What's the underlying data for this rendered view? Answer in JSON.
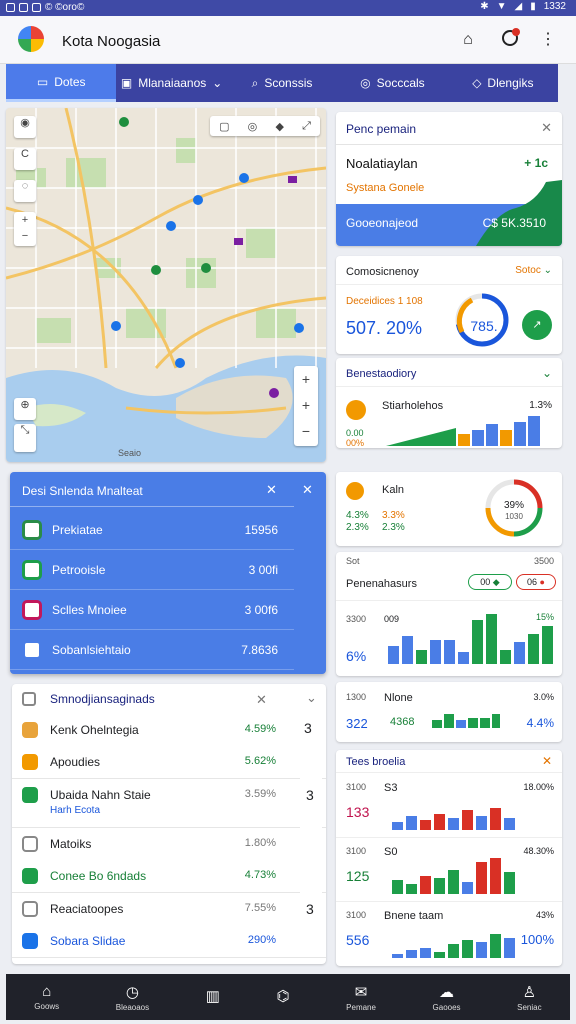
{
  "status": {
    "left": "© ©oro©",
    "right": "1332"
  },
  "header": {
    "title": "Kota Noogasia"
  },
  "tabs": [
    {
      "label": "Dotes",
      "active": true
    },
    {
      "label": "Mlanaiaanos",
      "active": false
    },
    {
      "label": "Sconssis",
      "active": false
    },
    {
      "label": "Socccals",
      "active": false
    },
    {
      "label": "Dlengiks",
      "active": false
    }
  ],
  "map": {
    "attribution": "Seaio"
  },
  "panel": {
    "title": "Penc pemain",
    "name": "Noalatiaylan",
    "change": "+ 1c",
    "subtitle": "Systana Gonele",
    "footer_label": "Gooeonajeod",
    "footer_value": "C$ 5K.3510"
  },
  "perf": {
    "title": "Comosicnenoy",
    "badge": "Sotoc",
    "sublabel": "Deceidices 1 108",
    "value": "507. 20%",
    "gauge_value": "785.",
    "gauge_pct": 72
  },
  "reco": {
    "title": "Benestaodiory",
    "item_label": "Stiarholehos",
    "item_pct": "1.3%",
    "small1": "0.00",
    "small2": "00%"
  },
  "kalo": {
    "label": "Kaln",
    "v1": "4.3%",
    "v2": "3.3%",
    "v3": "2.3%",
    "v4": "2.3%",
    "donut": "39%",
    "donut_sub": "1030"
  },
  "personal": {
    "label_top": "Sot",
    "right_top": "3500",
    "title": "Penenahasurs",
    "chip1": "00",
    "chip2": "06",
    "y1": "3300",
    "y2": "009",
    "r_top": "15%",
    "big": "6%"
  },
  "nlone": {
    "y": "1300",
    "title": "Nlone",
    "right": "3.0%",
    "v1": "322",
    "v2": "4368",
    "v3": "4.4%"
  },
  "tees": {
    "title": "Tees broelia",
    "rows": [
      {
        "y": "3100",
        "tag": "S3",
        "right": "18.00%",
        "big": "133",
        "big_color": "#c0134d"
      },
      {
        "y": "3100",
        "tag": "S0",
        "right": "48.30%",
        "big": "125",
        "big_color": "#188038"
      },
      {
        "y": "3100",
        "tag": "Bnene taam",
        "right": "43%",
        "big": "556",
        "big_color": "#1a56db",
        "pct": "100%"
      }
    ]
  },
  "dark_panel": {
    "title": "Desi Snlenda Mnalteat",
    "items": [
      {
        "label": "Prekiatae",
        "value": "15956",
        "color": "#2a8c48"
      },
      {
        "label": "Petrooisle",
        "value": "3 00fi",
        "color": "#1e9e4a"
      },
      {
        "label": "Sclles Mnoiee",
        "value": "3 00f6",
        "color": "#c2185b"
      },
      {
        "label": "Sobanlsiehtaio",
        "value": "7.8636",
        "color": "#ffffff"
      }
    ]
  },
  "list_panel": {
    "title": "Smnodjiansaginads",
    "right": "3",
    "groups": [
      {
        "num": "",
        "items": [
          {
            "label": "Kenk Ohelntegia",
            "value": "4.59%",
            "vcolor": "#188038",
            "icolor": "#e8a33a"
          },
          {
            "label": "Apoudies",
            "value": "5.62%",
            "vcolor": "#188038",
            "icolor": "#f29900"
          }
        ]
      },
      {
        "num": "3",
        "items": [
          {
            "label": "Ubaida Nahn Staie",
            "sub": "Harh Ecota",
            "value": "3.59%",
            "vcolor": "#777",
            "icolor": "#1e9e4a"
          }
        ]
      },
      {
        "num": "",
        "items": [
          {
            "label": "Matoiks",
            "value": "1.80%",
            "vcolor": "#777",
            "icolor": "#888"
          },
          {
            "label": "Conee Bo 6ndads",
            "value": "4.73%",
            "vcolor": "#188038",
            "icolor": "#1e9e4a",
            "lcolor": "#188038"
          }
        ]
      },
      {
        "num": "3",
        "items": [
          {
            "label": "Reaciatoopes",
            "value": "7.55%",
            "vcolor": "#777",
            "icolor": "#888"
          },
          {
            "label": "Sobara Slidae",
            "value": "290%",
            "vcolor": "#1a56db",
            "icolor": "#1a73e8",
            "lcolor": "#1a56db"
          }
        ]
      }
    ]
  },
  "nav": [
    {
      "label": "Goows",
      "icon": "home-icon"
    },
    {
      "label": "Bleaoaos",
      "icon": "clock-icon"
    },
    {
      "label": "",
      "icon": "book-icon"
    },
    {
      "label": "",
      "icon": "map-fold-icon"
    },
    {
      "label": "Pemane",
      "icon": "mail-icon"
    },
    {
      "label": "Gaooes",
      "icon": "cloud-icon"
    },
    {
      "label": "Seniac",
      "icon": "person-icon"
    }
  ]
}
